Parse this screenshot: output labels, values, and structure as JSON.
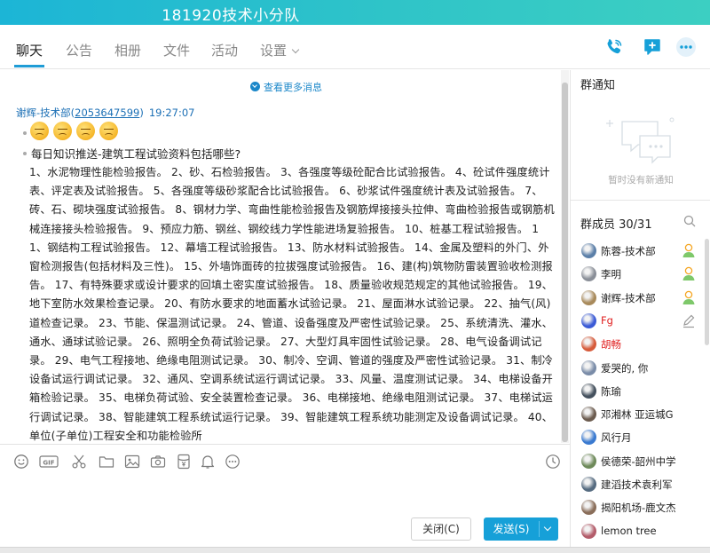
{
  "window": {
    "title": "181920技术小分队"
  },
  "tabs": [
    {
      "label": "聊天",
      "active": true
    },
    {
      "label": "公告"
    },
    {
      "label": "相册"
    },
    {
      "label": "文件"
    },
    {
      "label": "活动"
    },
    {
      "label": "设置"
    }
  ],
  "topbar_icons": [
    "phone-icon",
    "add-app-icon",
    "more-icon"
  ],
  "chat": {
    "view_more": "查看更多消息",
    "sender_name": "谢辉-技术部",
    "sender_id_open": "(",
    "sender_id": "2053647599",
    "sender_id_close": ")",
    "time": "19:27:07",
    "emoji_count": 4,
    "message_title": "每日知识推送-建筑工程试验资料包括哪些?",
    "message_body": "1、水泥物理性能检验报告。 2、砂、石检验报告。 3、各强度等级砼配合比试验报告。 4、砼试件强度统计表、评定表及试验报告。 5、各强度等级砂浆配合比试验报告。 6、砂浆试件强度统计表及试验报告。 7、砖、石、砌块强度试验报告。 8、钢材力学、弯曲性能检验报告及钢筋焊接接头拉伸、弯曲检验报告或钢筋机械连接接头检验报告。 9、预应力筋、钢丝、钢绞线力学性能进场复验报告。 10、桩基工程试验报告。 11、钢结构工程试验报告。 12、幕墙工程试验报告。 13、防水材料试验报告。 14、金属及塑料的外门、外窗检测报告(包括材料及三性)。 15、外墙饰面砖的拉拔强度试验报告。 16、建(构)筑物防雷装置验收检测报告。 17、有特殊要求或设计要求的回填土密实度试验报告。 18、质量验收规范规定的其他试验报告。 19、地下室防水效果检查记录。 20、有防水要求的地面蓄水试验记录。 21、屋面淋水试验记录。 22、抽气(风)道检查记录。 23、节能、保温测试记录。 24、管道、设备强度及严密性试验记录。 25、系统清洗、灌水、通水、通球试验记录。 26、照明全负荷试验记录。 27、大型灯具牢固性试验记录。 28、电气设备调试记录。 29、电气工程接地、绝缘电阻测试记录。 30、制冷、空调、管道的强度及严密性试验记录。 31、制冷设备试运行调试记录。 32、通风、空调系统试运行调试记录。 33、风量、温度测试记录。 34、电梯设备开箱检验记录。 35、电梯负荷试验、安全装置检查记录。 36、电梯接地、绝缘电阻测试记录。 37、电梯试运行调试记录。 38、智能建筑工程系统试运行记录。 39、智能建筑工程系统功能测定及设备调试记录。 40、单位(子单位)工程安全和功能检验所"
  },
  "toolbar_icons": [
    "emoji-icon",
    "gif-icon",
    "scissors-icon",
    "folder-icon",
    "image-icon",
    "camera-icon",
    "red-packet-icon",
    "bell-icon",
    "more-dots-icon",
    "history-icon"
  ],
  "toolbar": {
    "gif_label": "GIF"
  },
  "buttons": {
    "close": "关闭(C)",
    "send": "发送(S)"
  },
  "right_panel": {
    "notice_title": "群通知",
    "notice_empty": "暂时没有新通知",
    "members_title": "群成员 30/31"
  },
  "members": [
    {
      "name": "陈蓉-技术部",
      "badge": "admin",
      "color": "#5b7fa8"
    },
    {
      "name": "李明",
      "badge": "admin",
      "color": "#8a8f98"
    },
    {
      "name": "谢辉-技术部",
      "badge": "admin",
      "color": "#a88a5b"
    },
    {
      "name": "Fg",
      "badge": "edit",
      "red": true,
      "color": "#3b5bd6"
    },
    {
      "name": "胡畅",
      "red": true,
      "color": "#d65b3b"
    },
    {
      "name": "爱哭的, 你",
      "color": "#7a8ca8"
    },
    {
      "name": "陈瑜",
      "color": "#45515e"
    },
    {
      "name": "邓湘林 亚运城G",
      "color": "#6b5b4e"
    },
    {
      "name": "风行月",
      "color": "#3a7ad0"
    },
    {
      "name": "侯德荣-韶州中学",
      "color": "#6e8a5a"
    },
    {
      "name": "建滔技术袁利军",
      "color": "#556b80"
    },
    {
      "name": "揭阳机场-鹿文杰",
      "color": "#8a6e5a"
    },
    {
      "name": "lemon tree",
      "color": "#b35c6a"
    }
  ],
  "colors": {
    "accent": "#16a0d8",
    "title_bar": "#2fc4c8",
    "admin_badge": "#f5a623"
  }
}
